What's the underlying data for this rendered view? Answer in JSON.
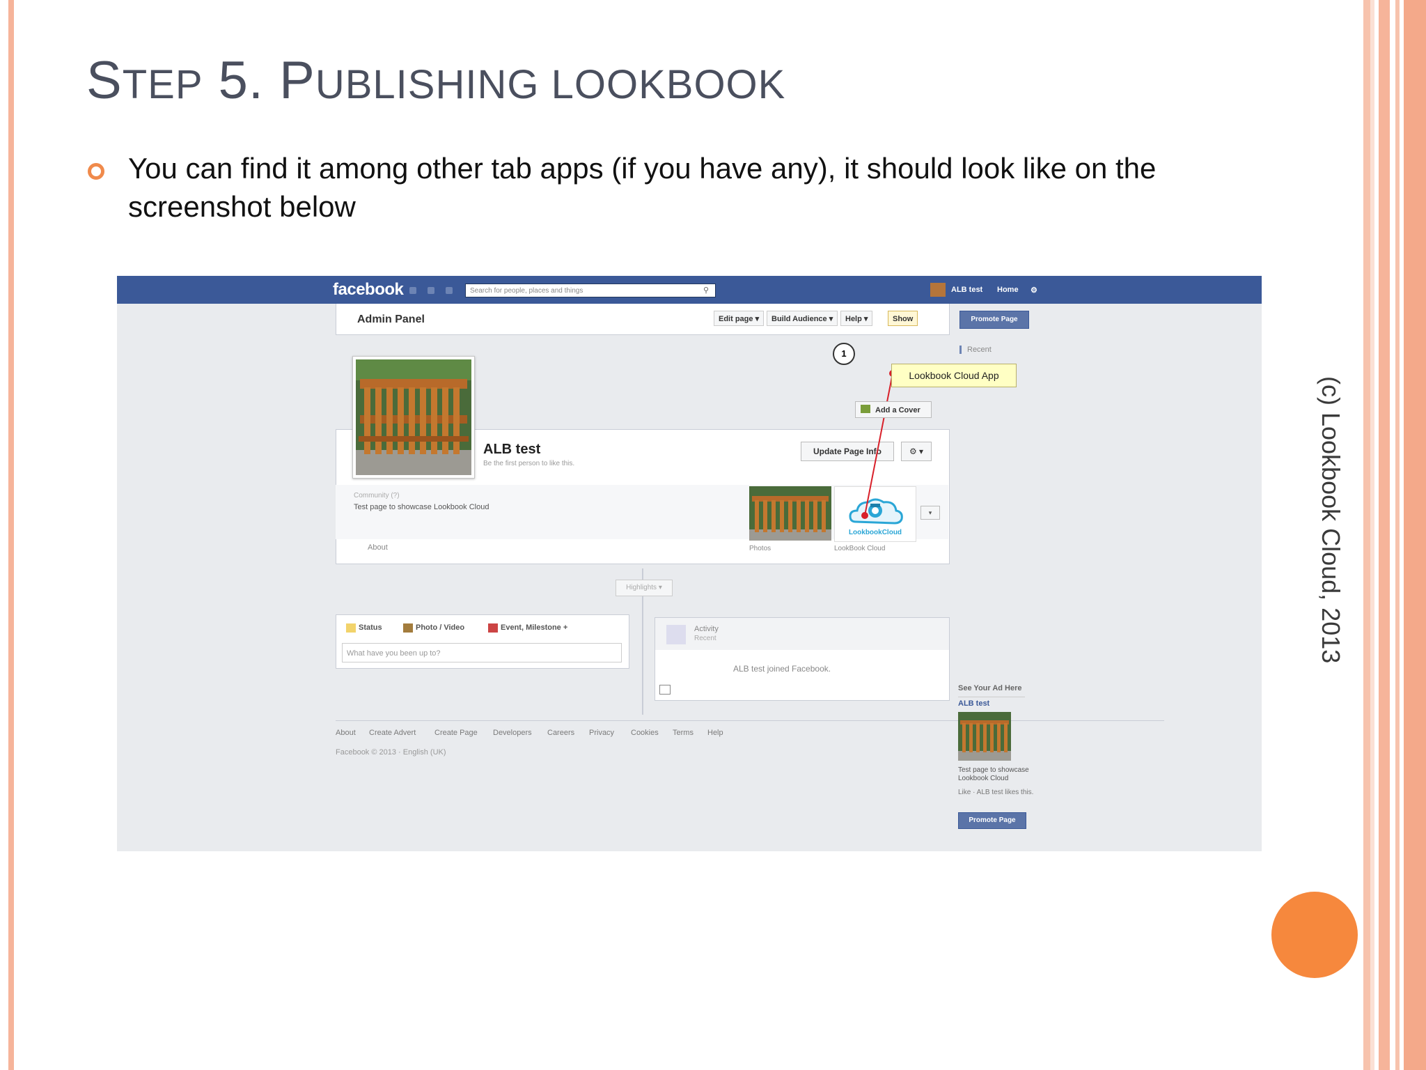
{
  "slide": {
    "title_initial_1": "S",
    "title_rest_1": "TEP",
    "title_mid": " 5. ",
    "title_initial_2": "P",
    "title_rest_2": "UBLISHING LOOKBOOK",
    "bullet": "You can find it among other tab apps (if you have any), it should look like on the screenshot below",
    "copyright": "(c) Lookbook Cloud, 2013",
    "colors": {
      "accent": "#f08a4b",
      "stripe": "#f6b49a",
      "circle": "#f6883d"
    }
  },
  "facebook": {
    "logo": "facebook",
    "search_placeholder": "Search for people, places and things",
    "top_links": {
      "user": "ALB test",
      "home": "Home"
    },
    "admin_panel": {
      "title": "Admin Panel",
      "buttons": [
        "Edit page",
        "Build Audience",
        "Help",
        "Show"
      ],
      "promote": "Promote Page"
    },
    "recent": "Recent",
    "annotation": {
      "number": "1",
      "tooltip": "Lookbook Cloud App"
    },
    "add_cover": "Add a Cover",
    "page": {
      "name": "ALB test",
      "subtitle": "Be the first person to like this.",
      "update_info": "Update Page Info",
      "category": "Community (?)",
      "description": "Test page to showcase Lookbook Cloud",
      "about": "About",
      "photos": "Photos",
      "app": "LookBook Cloud",
      "app_logo": "LookbookCloud"
    },
    "highlights": "Highlights",
    "composer": {
      "tabs": [
        "Status",
        "Photo / Video",
        "Event, Milestone +"
      ],
      "placeholder": "What have you been up to?"
    },
    "activity": {
      "title": "Activity",
      "sub": "Recent",
      "text": "ALB test joined Facebook."
    },
    "footer": {
      "links": [
        "About",
        "Create Advert",
        "Create Page",
        "Developers",
        "Careers",
        "Privacy",
        "Cookies",
        "Terms",
        "Help"
      ],
      "copyright": "Facebook © 2013 · English (UK)"
    },
    "ad": {
      "header": "See Your Ad Here",
      "name": "ALB test",
      "description": "Test page to showcase Lookbook Cloud",
      "like": "Like · ALB test likes this.",
      "promote": "Promote Page"
    }
  }
}
